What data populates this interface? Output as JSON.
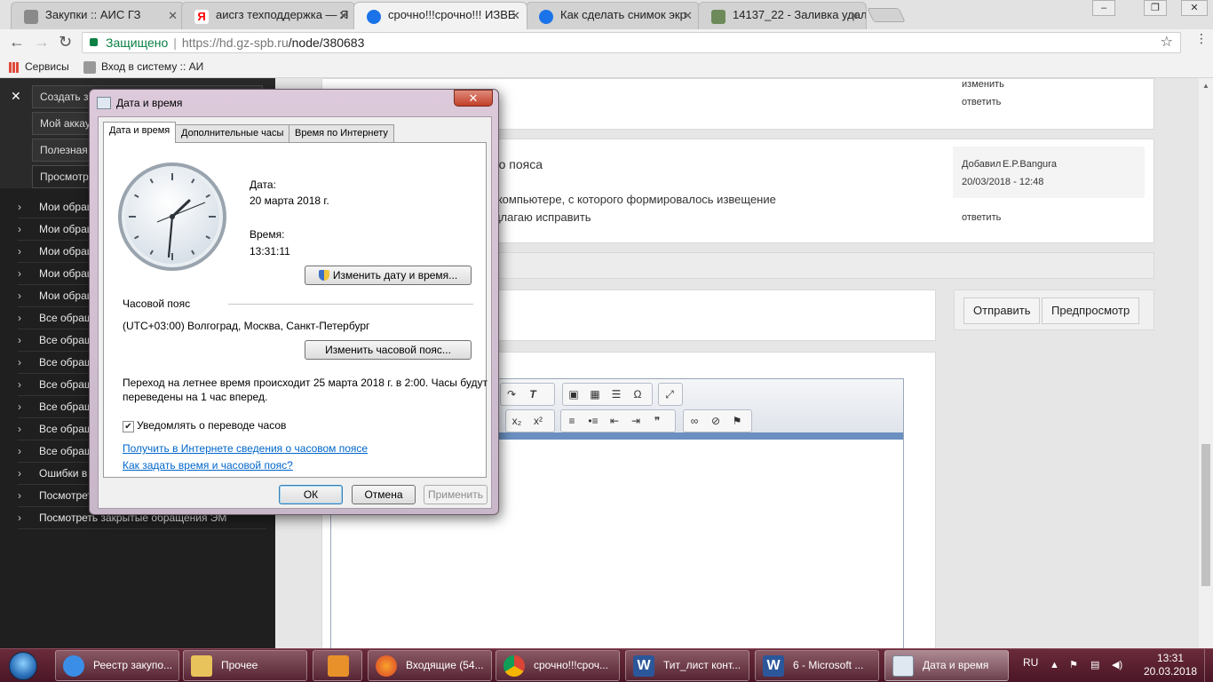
{
  "browser": {
    "tabs": [
      {
        "title": "Закупки :: АИС ГЗ",
        "color": "#8a8a8a"
      },
      {
        "title": "аисгз техподдержка — Я",
        "color": "#ff0000"
      },
      {
        "title": "срочно!!!срочно!!! ИЗВЕ",
        "color": "#1a73e8"
      },
      {
        "title": "Как сделать снимок экр",
        "color": "#1a73e8"
      },
      {
        "title": "14137_22 - Заливка удал",
        "color": "#6d8a5a"
      }
    ],
    "window_controls": {
      "minimize": "–",
      "restore": "❐",
      "close": "✕"
    },
    "address": {
      "secure_label": "Защищено",
      "url_host": "https://hd.gz-spb.ru",
      "url_path": "/node/380683"
    },
    "bookmarks": [
      {
        "label": "Сервисы"
      },
      {
        "label": "Вход в систему :: АИ"
      }
    ]
  },
  "sidebar": {
    "close": "✕",
    "buttons": [
      "Создать заявку",
      "Мой аккаунт",
      "Полезная информация",
      "Просмотр обращений"
    ],
    "links": [
      "Мои обращения",
      "Мои обращения",
      "Мои обращения",
      "Мои обращения",
      "Мои обращения",
      "Все обращения",
      "Все обращения",
      "Все обращения",
      "Все обращения",
      "Все обращения",
      "Все обращения",
      "Все обращения",
      "Ошибки в",
      "Посмотреть",
      "Посмотреть закрытые обращения ЭМ"
    ]
  },
  "content": {
    "top_links": {
      "edit": "изменить",
      "reply": "ответить"
    },
    "comment": {
      "title_fragment": "ого пояса",
      "body_line1": "а компьютере, с которого формировалось извещение",
      "body_line2": "едлагаю исправить",
      "added_by_label": "Добавил",
      "author": "E.P.Bangura",
      "datetime": "20/03/2018 - 12:48",
      "reply": "ответить"
    },
    "send_button": "Отправить",
    "preview_button": "Предпросмотр"
  },
  "dialog": {
    "title": "Дата и время",
    "close": "✕",
    "tabs": [
      "Дата и время",
      "Дополнительные часы",
      "Время по Интернету"
    ],
    "date_label": "Дата:",
    "date_value": "20 марта 2018 г.",
    "time_label": "Время:",
    "time_value": "13:31:11",
    "change_datetime_button": "Изменить дату и время...",
    "timezone_section": "Часовой пояс",
    "timezone_value": "(UTC+03:00) Волгоград, Москва, Санкт-Петербург",
    "change_timezone_button": "Изменить часовой пояс...",
    "dst_line1": "Переход на летнее время происходит 25 марта 2018 г. в 2:00. Часы будут",
    "dst_line2": "переведены на 1 час вперед.",
    "notify_label": "Уведомлять о переводе часов",
    "notify_checked": true,
    "link_internet": "Получить в Интернете сведения о часовом поясе",
    "link_howto": "Как задать время и часовой пояс?",
    "ok": "ОК",
    "cancel": "Отмена",
    "apply": "Применить"
  },
  "taskbar": {
    "items": [
      {
        "label": "Реестр закупо...",
        "icon": "ie-icon"
      },
      {
        "label": "Прочее",
        "icon": "folder-icon"
      },
      {
        "label": "",
        "icon": "media-player-icon"
      },
      {
        "label": "Входящие (54...",
        "icon": "firefox-icon"
      },
      {
        "label": "срочно!!!сроч...",
        "icon": "chrome-icon"
      },
      {
        "label": "Тит_лист конт...",
        "icon": "word-icon"
      },
      {
        "label": "6 - Microsoft ...",
        "icon": "word-icon"
      },
      {
        "label": "Дата и время",
        "icon": "datetime-icon"
      }
    ],
    "lang": "RU",
    "clock_time": "13:31",
    "clock_date": "20.03.2018"
  }
}
